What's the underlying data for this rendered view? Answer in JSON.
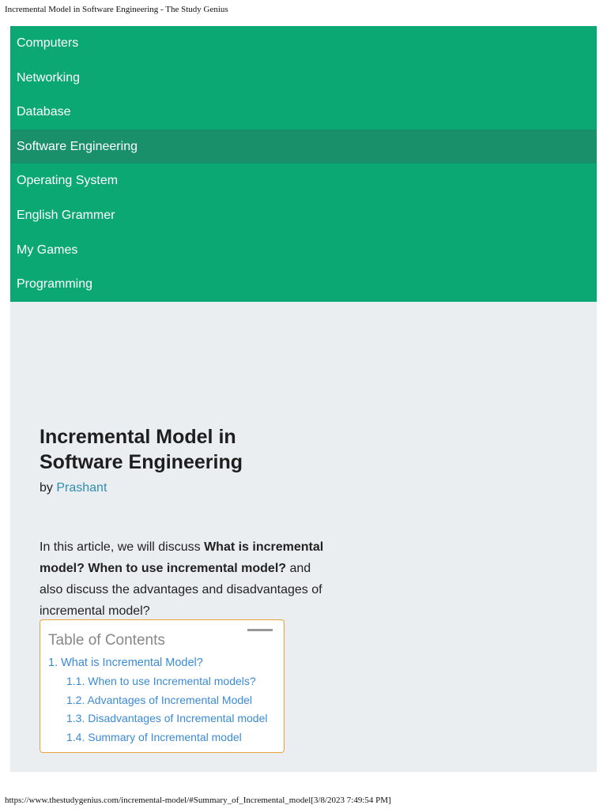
{
  "print_header": "Incremental Model in Software Engineering - The Study Genius",
  "print_footer": "https://www.thestudygenius.com/incremental-model/#Summary_of_Incremental_model[3/8/2023 7:49:54 PM]",
  "nav": [
    "Computers",
    "Networking",
    "Database",
    "Software Engineering",
    "Operating System",
    "English Grammer",
    "My Games",
    "Programming"
  ],
  "article": {
    "title": "Incremental Model in Software Engineering",
    "by": "by",
    "author": "Prashant",
    "intro_1": "In this article, we will discuss ",
    "intro_bold": "What is incremental model? When to use incremental model?",
    "intro_2": " and also discuss the advantages and disadvantages of incremental model?"
  },
  "toc": {
    "title": "Table of Contents",
    "items": [
      "1. What is Incremental Model?",
      "1.1. When to use Incremental models?",
      "1.2. Advantages of Incremental Model",
      "1.3. Disadvantages of Incremental model",
      "1.4. Summary of Incremental model"
    ]
  }
}
